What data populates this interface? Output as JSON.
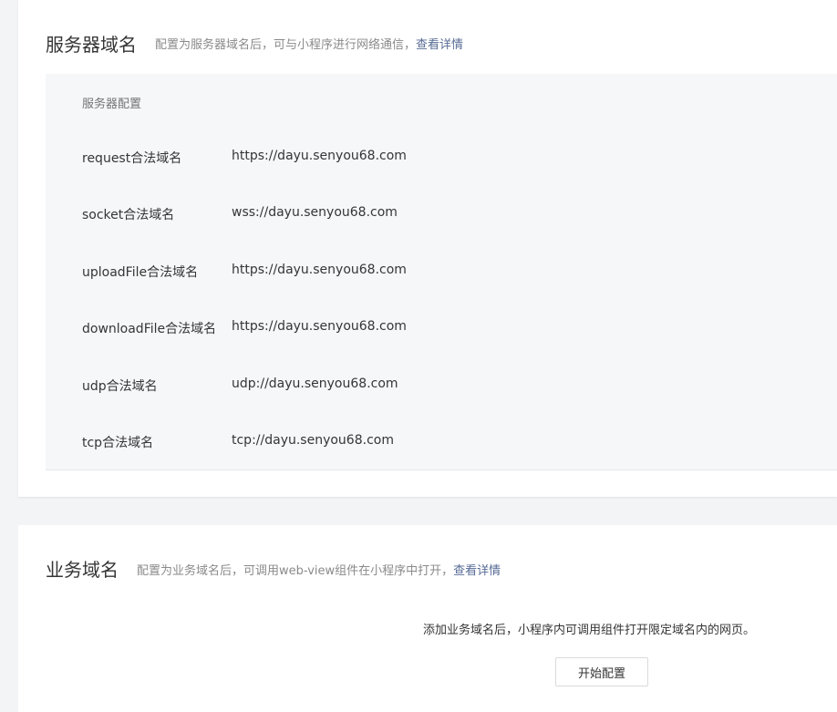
{
  "server_domain": {
    "title": "服务器域名",
    "desc": "配置为服务器域名后，可与小程序进行网络通信，",
    "link": "查看详情",
    "table_header": "服务器配置",
    "rows": [
      {
        "label": "request合法域名",
        "value": "https://dayu.senyou68.com"
      },
      {
        "label": "socket合法域名",
        "value": "wss://dayu.senyou68.com"
      },
      {
        "label": "uploadFile合法域名",
        "value": "https://dayu.senyou68.com"
      },
      {
        "label": "downloadFile合法域名",
        "value": "https://dayu.senyou68.com"
      },
      {
        "label": "udp合法域名",
        "value": "udp://dayu.senyou68.com"
      },
      {
        "label": "tcp合法域名",
        "value": "tcp://dayu.senyou68.com"
      }
    ]
  },
  "business_domain": {
    "title": "业务域名",
    "desc": "配置为业务域名后，可调用web-view组件在小程序中打开，",
    "link": "查看详情",
    "empty_hint": "添加业务域名后，小程序内可调用组件打开限定域名内的网页。",
    "start_button": "开始配置"
  },
  "colors": {
    "link": "#576b95",
    "text": "#353535",
    "muted": "#8a8a8a",
    "table_bg": "#f6f7f9",
    "page_bg": "#f3f4f6"
  }
}
